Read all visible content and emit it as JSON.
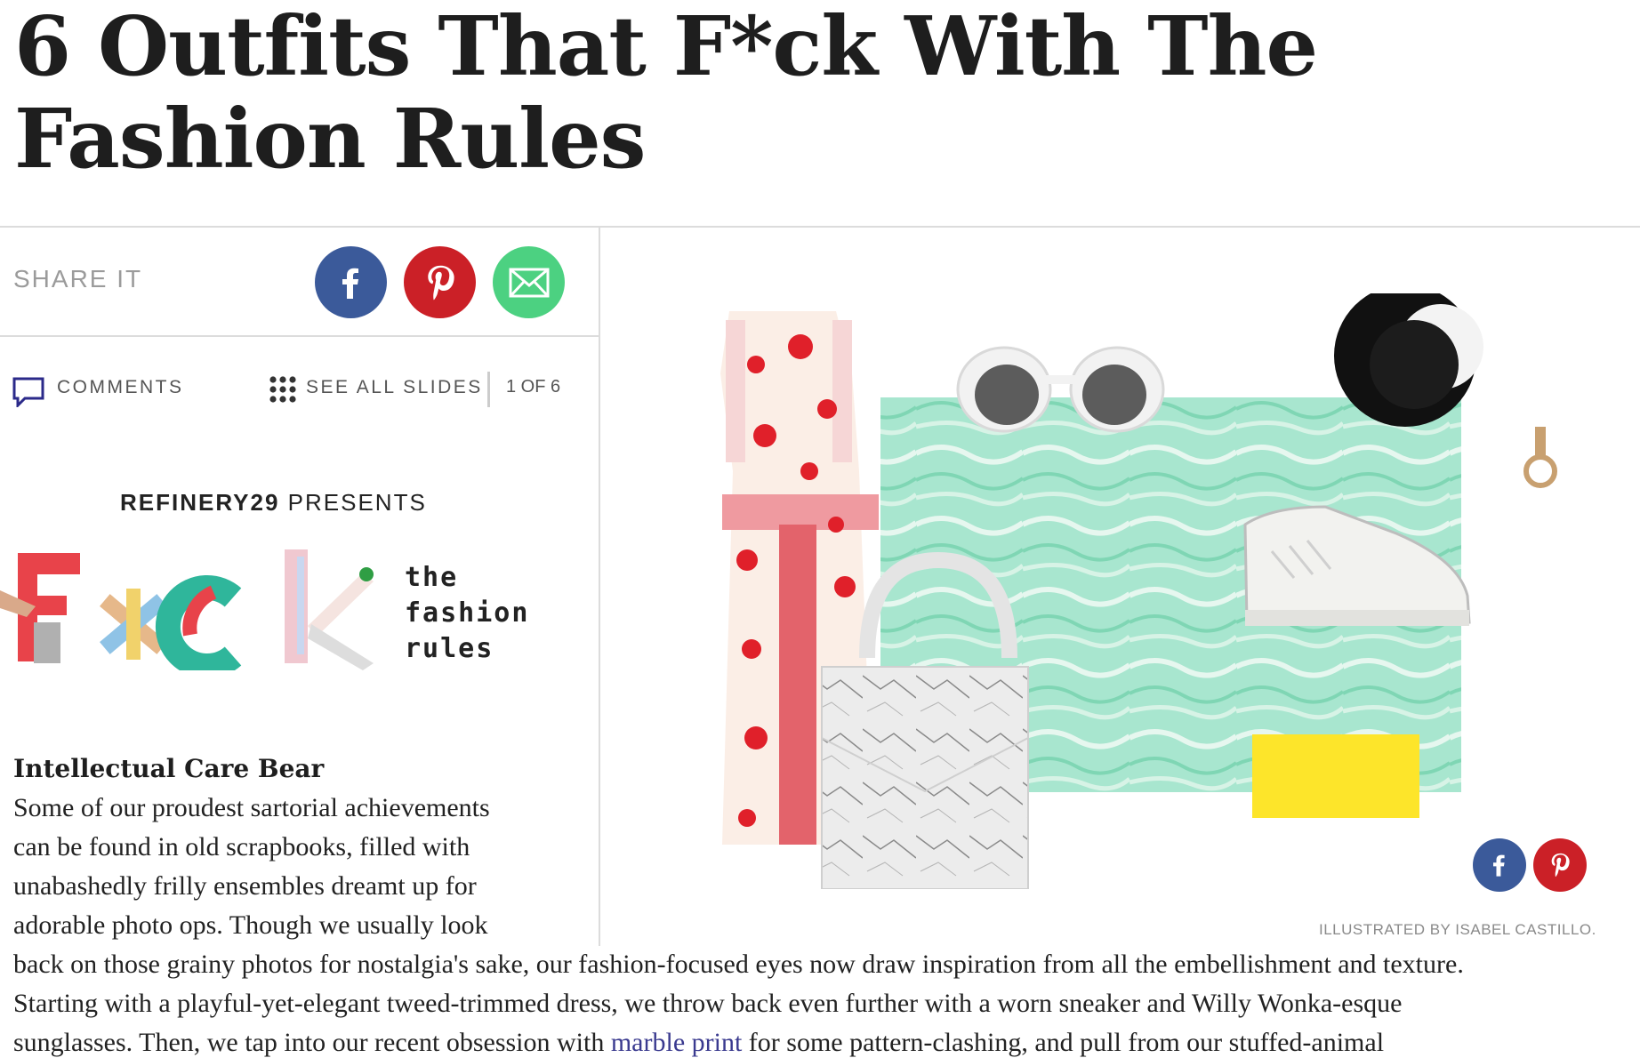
{
  "article": {
    "headline": "6 Outfits That F*ck With The Fashion Rules"
  },
  "share": {
    "label": "SHARE IT",
    "buttons": [
      {
        "name": "facebook",
        "icon": "facebook-icon",
        "color": "#3b5a9a"
      },
      {
        "name": "pinterest",
        "icon": "pinterest-icon",
        "color": "#cb2027"
      },
      {
        "name": "email",
        "icon": "mail-icon",
        "color": "#4cd181"
      }
    ]
  },
  "toolbar": {
    "comments_label": "COMMENTS",
    "comments_icon": "comment-icon",
    "see_all_label": "SEE ALL SLIDES",
    "see_all_icon": "grid-icon",
    "slide_counter": "1 OF 6"
  },
  "presents": {
    "brand": "REFINERY29",
    "word": "PRESENTS",
    "logo_text": "F*ck",
    "tagline": [
      "the",
      "fashion",
      "rules"
    ]
  },
  "slide": {
    "title": "Intellectual Care Bear",
    "lines": [
      "Some of our proudest sartorial achievements",
      "can be found in old scrapbooks, filled with",
      "unabashedly frilly ensembles dreamt up for",
      "adorable photo ops. Though we usually look",
      "back on those grainy photos for nostalgia's sake, our fashion-focused eyes now draw inspiration from all the embellishment and texture.",
      "Starting with a playful-yet-elegant tweed-trimmed dress, we throw back even further with a worn sneaker and Willy Wonka-esque"
    ],
    "last_line": {
      "before": "sunglasses. Then, we tap into our recent obsession with ",
      "link": "marble print",
      "after": " for some pattern-clashing, and pull from our stuffed-animal"
    }
  },
  "illustration": {
    "credit": "ILLUSTRATED BY ISABEL CASTILLO.",
    "colors": {
      "marble": "#a8e6cf",
      "yellow": "#fde52a",
      "dress_red": "#e0202a"
    }
  }
}
